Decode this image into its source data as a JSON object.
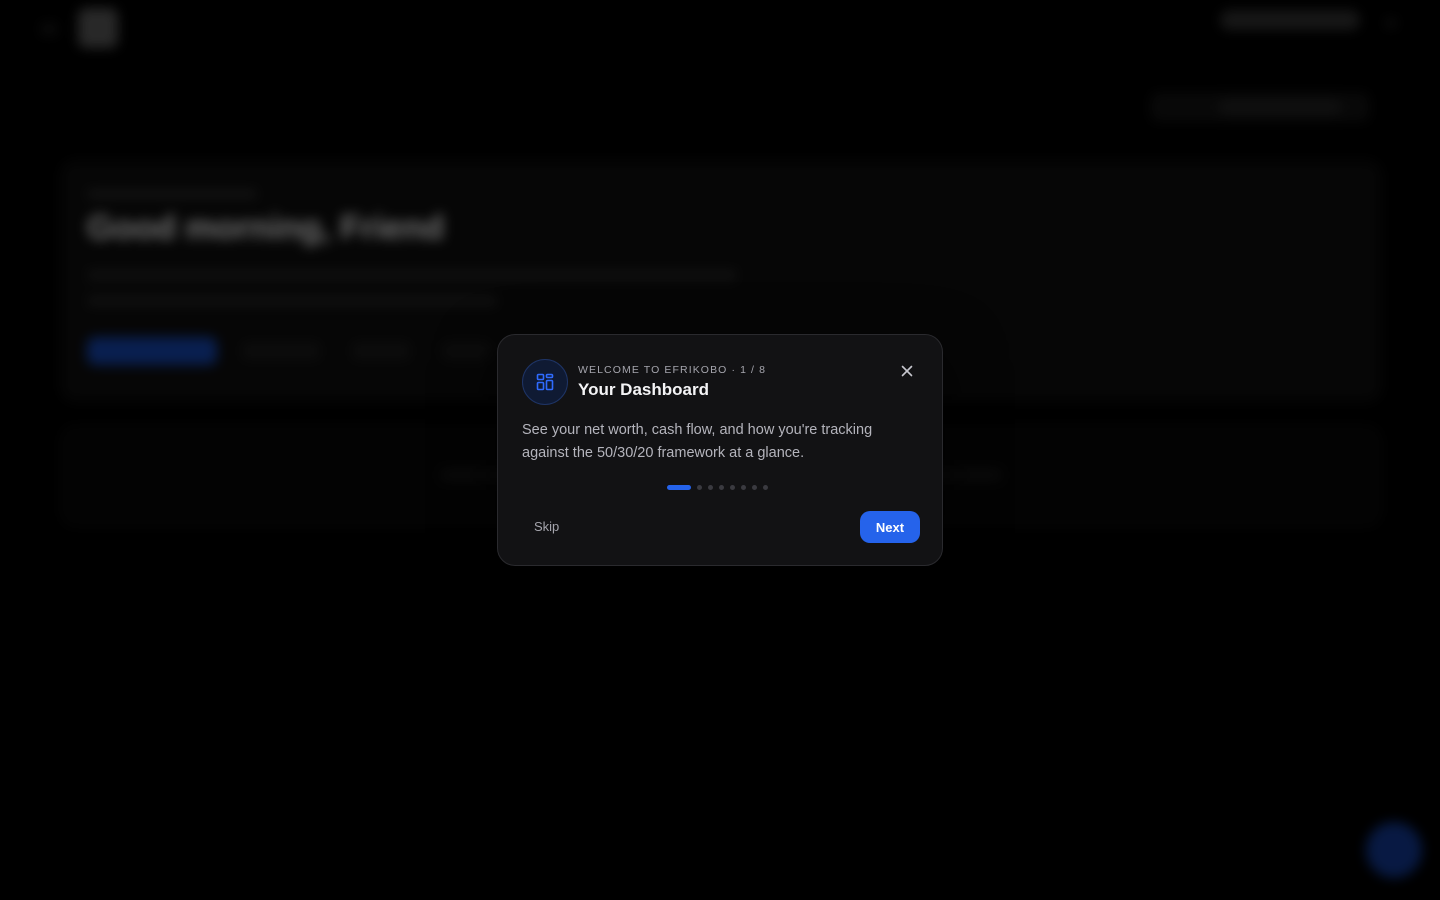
{
  "background": {
    "greeting": "Good morning, Friend"
  },
  "modal": {
    "eyebrow": "WELCOME TO EFRIKOBO · 1 / 8",
    "title": "Your Dashboard",
    "description": "See your net worth, cash flow, and how you're tracking against the 50/30/20 framework at a glance.",
    "icon": "dashboard-grid-icon",
    "close_icon": "close-icon",
    "step_current": 1,
    "step_total": 8,
    "skip_label": "Skip",
    "next_label": "Next"
  },
  "colors": {
    "accent": "#2563eb",
    "modal_bg": "#121214",
    "page_bg": "#000000"
  }
}
